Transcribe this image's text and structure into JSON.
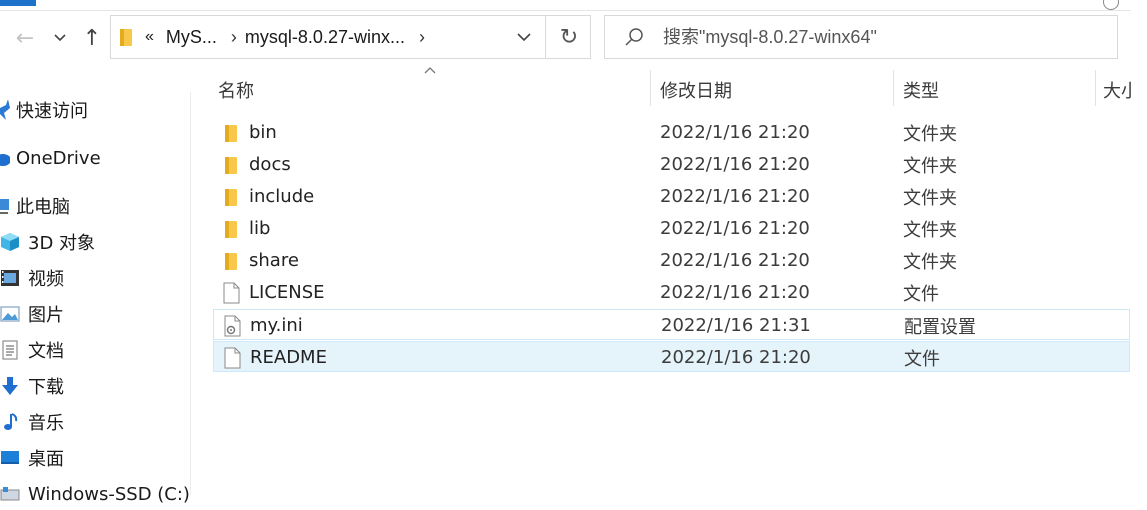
{
  "toolbar": {
    "back_icon": "←",
    "recent_icon": "⌄",
    "up_icon": "↑"
  },
  "address": {
    "overflow": "«",
    "crumbs": [
      "MyS...",
      "mysql-8.0.27-winx..."
    ],
    "separator": "›",
    "refresh_icon": "↻"
  },
  "search": {
    "placeholder": "搜索\"mysql-8.0.27-winx64\""
  },
  "columns": {
    "name": "名称",
    "date": "修改日期",
    "type": "类型",
    "size": "大小"
  },
  "sidebar": {
    "items": [
      {
        "label": "快速访问",
        "icon": "star-icon"
      },
      {
        "label": "OneDrive",
        "icon": "cloud-icon"
      },
      {
        "label": "此电脑",
        "icon": "computer-icon"
      },
      {
        "label": "3D 对象",
        "icon": "cube-icon"
      },
      {
        "label": "视频",
        "icon": "video-icon"
      },
      {
        "label": "图片",
        "icon": "picture-icon"
      },
      {
        "label": "文档",
        "icon": "document-icon"
      },
      {
        "label": "下载",
        "icon": "download-icon"
      },
      {
        "label": "音乐",
        "icon": "music-icon"
      },
      {
        "label": "桌面",
        "icon": "desktop-icon"
      },
      {
        "label": "Windows-SSD (C:)",
        "icon": "drive-icon"
      }
    ]
  },
  "files": [
    {
      "name": "bin",
      "date": "2022/1/16 21:20",
      "type": "文件夹",
      "icon": "folder-icon"
    },
    {
      "name": "docs",
      "date": "2022/1/16 21:20",
      "type": "文件夹",
      "icon": "folder-icon"
    },
    {
      "name": "include",
      "date": "2022/1/16 21:20",
      "type": "文件夹",
      "icon": "folder-icon"
    },
    {
      "name": "lib",
      "date": "2022/1/16 21:20",
      "type": "文件夹",
      "icon": "folder-icon"
    },
    {
      "name": "share",
      "date": "2022/1/16 21:20",
      "type": "文件夹",
      "icon": "folder-icon"
    },
    {
      "name": "LICENSE",
      "date": "2022/1/16 21:20",
      "type": "文件",
      "icon": "file-icon"
    },
    {
      "name": "my.ini",
      "date": "2022/1/16 21:31",
      "type": "配置设置",
      "icon": "config-file-icon"
    },
    {
      "name": "README",
      "date": "2022/1/16 21:20",
      "type": "文件",
      "icon": "file-icon"
    }
  ],
  "colors": {
    "folder": "#f7c84a",
    "selection": "#e5f3fb",
    "accent": "#1f72c9"
  }
}
